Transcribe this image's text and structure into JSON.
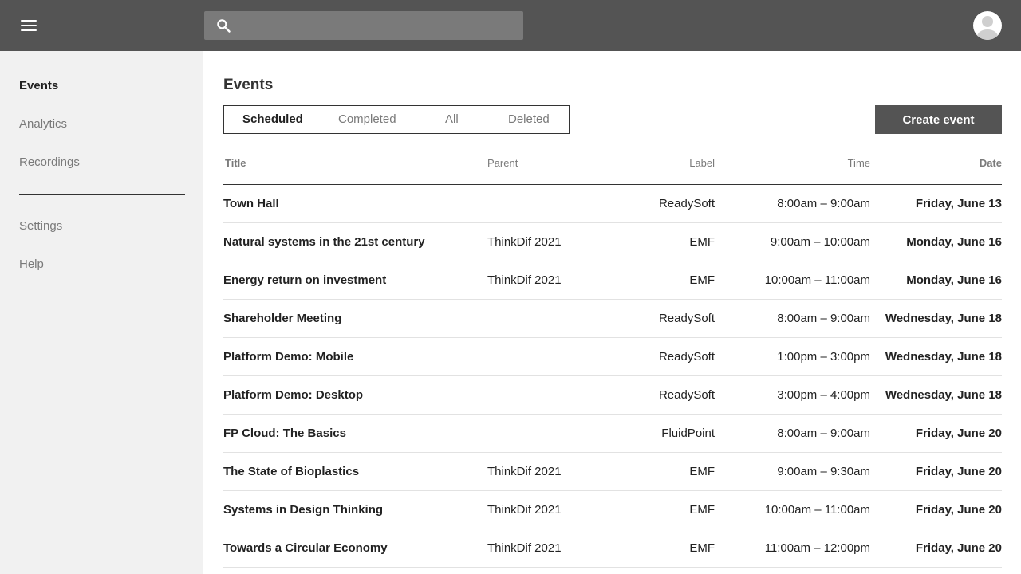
{
  "header": {
    "search": {
      "placeholder": "",
      "value": ""
    }
  },
  "sidebar": {
    "items": [
      {
        "label": "Events",
        "active": true
      },
      {
        "label": "Analytics",
        "active": false
      },
      {
        "label": "Recordings",
        "active": false
      }
    ],
    "secondary_items": [
      {
        "label": "Settings"
      },
      {
        "label": "Help"
      }
    ]
  },
  "main": {
    "title": "Events",
    "tabs": [
      {
        "label": "Scheduled",
        "active": true
      },
      {
        "label": "Completed",
        "active": false
      },
      {
        "label": "All",
        "active": false
      },
      {
        "label": "Deleted",
        "active": false
      }
    ],
    "create_button": "Create event",
    "table": {
      "columns": [
        "Title",
        "Parent",
        "Label",
        "Time",
        "Date"
      ],
      "rows": [
        {
          "title": "Town Hall",
          "parent": "",
          "label": "ReadySoft",
          "time": "8:00am – 9:00am",
          "date": "Friday, June 13"
        },
        {
          "title": "Natural systems in the 21st century",
          "parent": "ThinkDif 2021",
          "label": "EMF",
          "time": "9:00am – 10:00am",
          "date": "Monday, June 16"
        },
        {
          "title": "Energy return on investment",
          "parent": "ThinkDif 2021",
          "label": "EMF",
          "time": "10:00am – 11:00am",
          "date": "Monday, June 16"
        },
        {
          "title": "Shareholder Meeting",
          "parent": "",
          "label": "ReadySoft",
          "time": "8:00am – 9:00am",
          "date": "Wednesday, June 18"
        },
        {
          "title": "Platform Demo: Mobile",
          "parent": "",
          "label": "ReadySoft",
          "time": "1:00pm – 3:00pm",
          "date": "Wednesday, June 18"
        },
        {
          "title": "Platform Demo: Desktop",
          "parent": "",
          "label": "ReadySoft",
          "time": "3:00pm – 4:00pm",
          "date": "Wednesday, June 18"
        },
        {
          "title": "FP Cloud: The Basics",
          "parent": "",
          "label": "FluidPoint",
          "time": "8:00am – 9:00am",
          "date": "Friday, June 20"
        },
        {
          "title": "The State of Bioplastics",
          "parent": "ThinkDif 2021",
          "label": "EMF",
          "time": "9:00am – 9:30am",
          "date": "Friday, June 20"
        },
        {
          "title": "Systems in Design Thinking",
          "parent": "ThinkDif 2021",
          "label": "EMF",
          "time": "10:00am – 11:00am",
          "date": "Friday, June 20"
        },
        {
          "title": "Towards a Circular Economy",
          "parent": "ThinkDif 2021",
          "label": "EMF",
          "time": "11:00am – 12:00pm",
          "date": "Friday, June 20"
        }
      ]
    }
  },
  "icons": {
    "menu": "menu-icon",
    "search": "search-icon",
    "avatar": "user-avatar-icon"
  },
  "colors": {
    "topbar": "#545454",
    "sidebar": "#f1f1f1",
    "primary_button": "#545454",
    "muted_text": "#7a7a7a"
  }
}
